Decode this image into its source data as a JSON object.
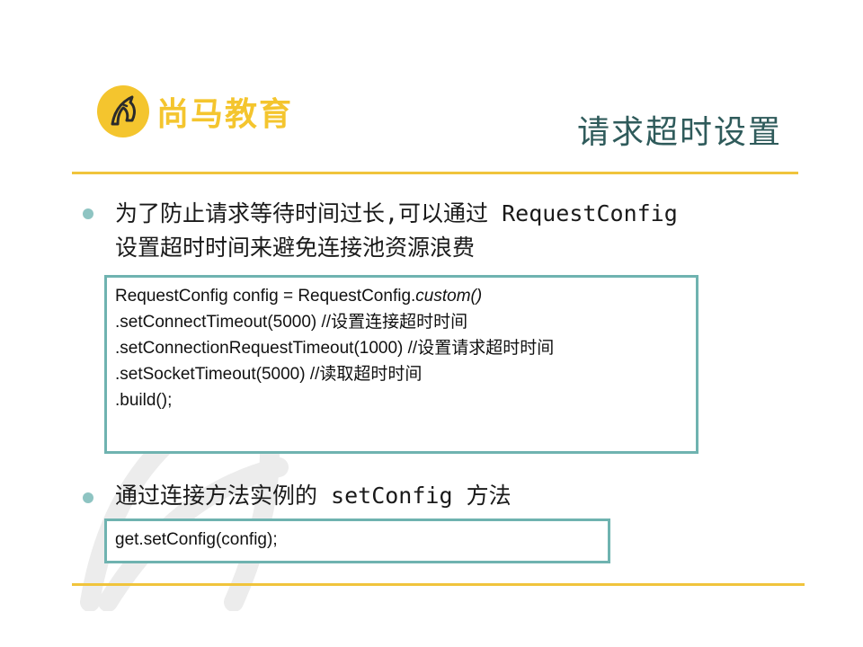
{
  "logo": {
    "text": "尚马教育",
    "icon": "horse-head-icon",
    "color": "#f4c52e"
  },
  "slide": {
    "title": "请求超时设置"
  },
  "bullets": [
    {
      "line1": "为了防止请求等待时间过长,可以通过 RequestConfig",
      "line2": "设置超时时间来避免连接池资源浪费"
    },
    {
      "line1": "通过连接方法实例的 setConfig 方法"
    }
  ],
  "code_block_1": {
    "line1_prefix": "RequestConfig config = RequestConfig.",
    "line1_italic": "custom()",
    "line2": ".setConnectTimeout(5000)  //设置连接超时时间",
    "line3": ".setConnectionRequestTimeout(1000) //设置请求超时时间",
    "line4": ".setSocketTimeout(5000) //读取超时时间",
    "line5": ".build();"
  },
  "code_block_2": {
    "line1": "get.setConfig(config);"
  },
  "colors": {
    "accent_gold": "#f0c43c",
    "teal_border": "#6fb3b0",
    "title_text": "#2f5b5b",
    "bullet": "#8ec4c2"
  }
}
